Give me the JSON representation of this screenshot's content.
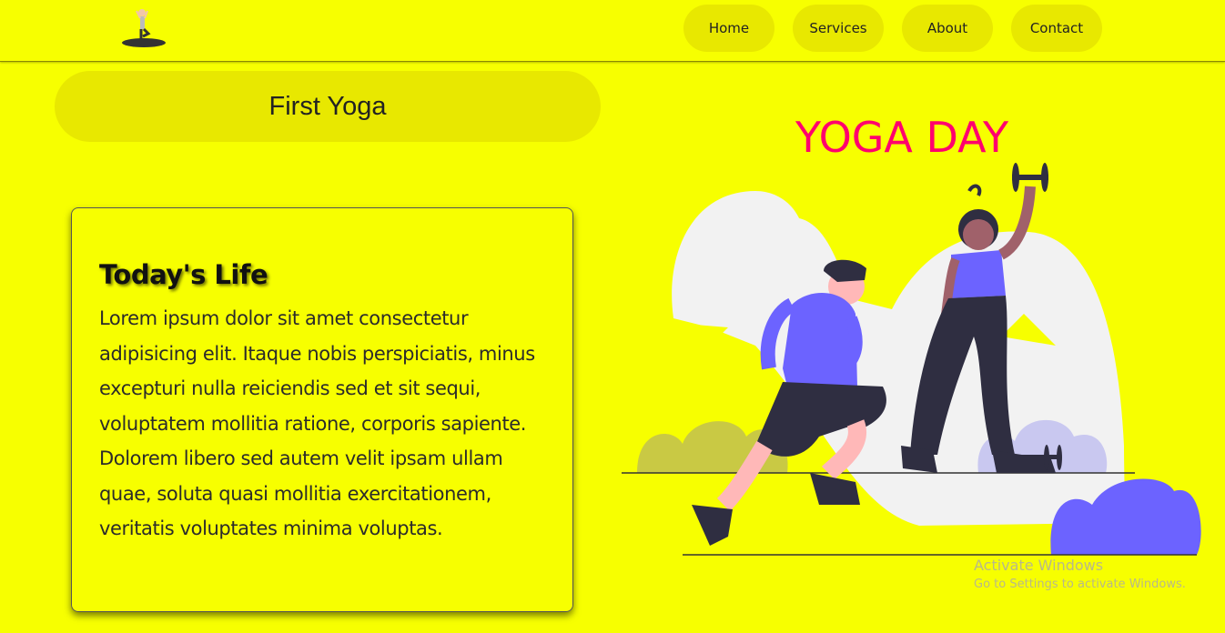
{
  "nav": {
    "logo_icon": "yoga-pose-icon",
    "items": [
      {
        "label": "Home"
      },
      {
        "label": "Services"
      },
      {
        "label": "About"
      },
      {
        "label": "Contact"
      }
    ]
  },
  "hero": {
    "pill_title": "First Yoga",
    "headline": "YOGA DAY",
    "illustration_icon": "workout-couple-illustration"
  },
  "card": {
    "title": "Today's Life",
    "body": "Lorem ipsum dolor sit amet consectetur adipisicing elit. Itaque nobis perspiciatis, minus excepturi nulla reiciendis sed et sit sequi, voluptatem mollitia ratione, corporis sapiente. Dolorem libero sed autem velit ipsam ullam quae, soluta quasi mollitia exercitationem, veritatis voluptates minima voluptas."
  },
  "watermark": {
    "line1": "Activate Windows",
    "line2": "Go to Settings to activate Windows."
  },
  "colors": {
    "background": "#f7ff00",
    "pill": "#e8e800",
    "headline": "#ff006e",
    "accent": "#6c63ff"
  }
}
